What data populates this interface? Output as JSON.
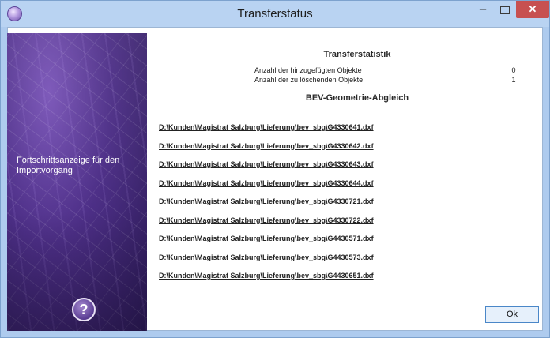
{
  "window": {
    "title": "Transferstatus",
    "controls": {
      "minimize": "–",
      "close": "✕"
    }
  },
  "sidebar": {
    "caption": "Fortschrittsanzeige für den Importvorgang",
    "help_symbol": "?"
  },
  "stats": {
    "heading": "Transferstatistik",
    "rows": [
      {
        "label": "Anzahl der hinzugefügten Objekte",
        "value": "0"
      },
      {
        "label": "Anzahl der zu löschenden Objekte",
        "value": "1"
      }
    ]
  },
  "geometry": {
    "heading": "BEV-Geometrie-Abgleich",
    "files": [
      "D:\\Kunden\\Magistrat Salzburg\\Lieferung\\bev_sbg\\G4330641.dxf",
      "D:\\Kunden\\Magistrat Salzburg\\Lieferung\\bev_sbg\\G4330642.dxf",
      "D:\\Kunden\\Magistrat Salzburg\\Lieferung\\bev_sbg\\G4330643.dxf",
      "D:\\Kunden\\Magistrat Salzburg\\Lieferung\\bev_sbg\\G4330644.dxf",
      "D:\\Kunden\\Magistrat Salzburg\\Lieferung\\bev_sbg\\G4330721.dxf",
      "D:\\Kunden\\Magistrat Salzburg\\Lieferung\\bev_sbg\\G4330722.dxf",
      "D:\\Kunden\\Magistrat Salzburg\\Lieferung\\bev_sbg\\G4430571.dxf",
      "D:\\Kunden\\Magistrat Salzburg\\Lieferung\\bev_sbg\\G4430573.dxf",
      "D:\\Kunden\\Magistrat Salzburg\\Lieferung\\bev_sbg\\G4430651.dxf"
    ]
  },
  "buttons": {
    "ok": "Ok"
  },
  "colors": {
    "close_button": "#c75050",
    "titlebar": "#b9d3f2",
    "sidebar": "#4d2f87"
  }
}
